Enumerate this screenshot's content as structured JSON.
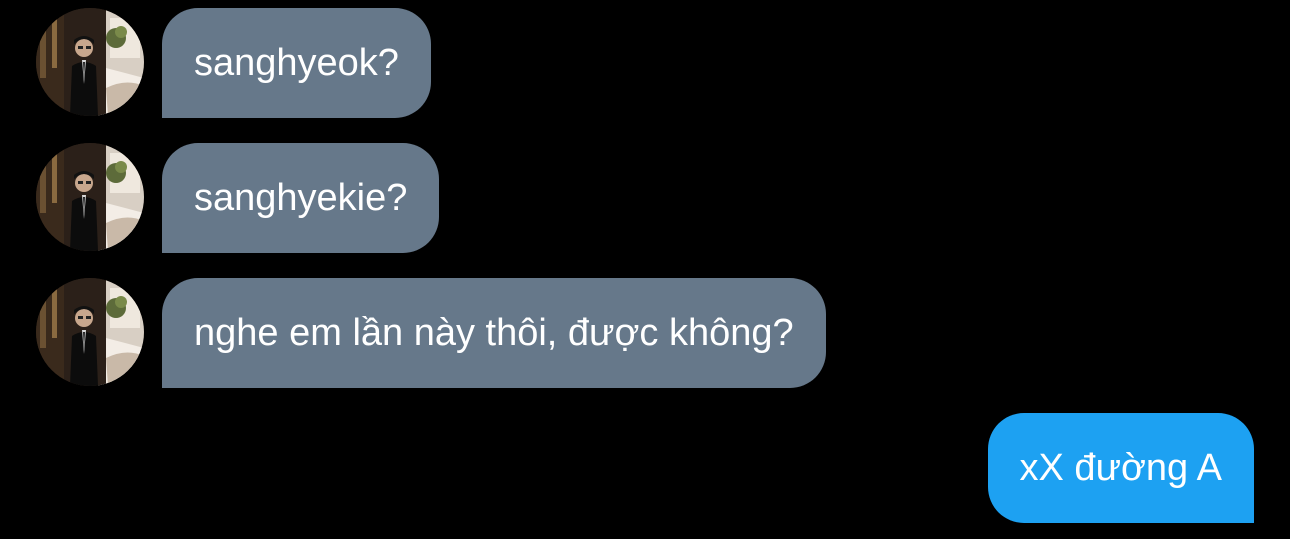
{
  "conversation": {
    "incoming_color": "#66788A",
    "outgoing_color": "#1DA1F2",
    "messages": [
      {
        "direction": "incoming",
        "text": "sanghyeok?",
        "avatar": "profile-photo"
      },
      {
        "direction": "incoming",
        "text": "sanghyekie?",
        "avatar": "profile-photo"
      },
      {
        "direction": "incoming",
        "text": "nghe em lần này thôi, được không?",
        "avatar": "profile-photo"
      },
      {
        "direction": "outgoing",
        "text": "xX đường A"
      }
    ]
  }
}
